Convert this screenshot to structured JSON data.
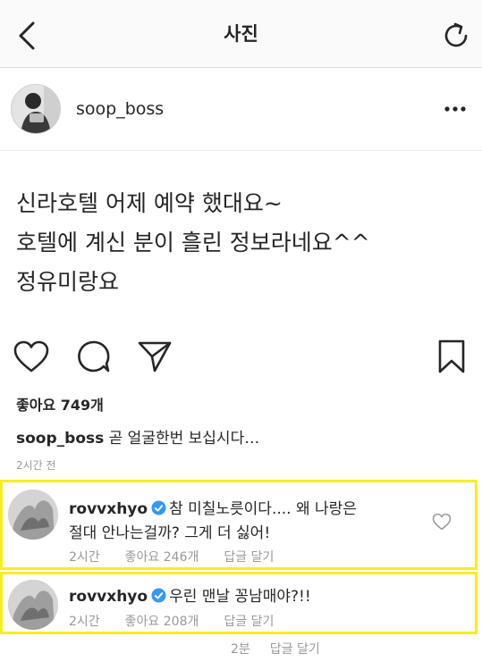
{
  "topbar": {
    "title": "사진",
    "back_icon": "chevron-left-icon",
    "refresh_icon": "refresh-icon"
  },
  "post": {
    "username": "soop_boss",
    "text_lines": [
      "신라호텔 어제 예약 했대요~",
      "호텔에 계신 분이 흘린 정보라네요^^",
      "정유미랑요"
    ],
    "likes": "좋아요 749개",
    "caption_user": "soop_boss",
    "caption_text": " 곧 얼굴한번 보십시다…",
    "time": "2시간 전"
  },
  "comments": [
    {
      "username": "rovvxhyo",
      "text_line1": "참 미칠노릇이다.... 왜 나랑은",
      "text_line2": "절대 안나는걸까?  그게 더 싫어!",
      "time": "2시간",
      "likes": "좋아요 246개",
      "reply": "답글 달기"
    },
    {
      "username": "rovvxhyo",
      "text_line1": "우린 맨날 꽁남매야?!!",
      "time": "2시간",
      "likes": "좋아요 208개",
      "reply": "답글 달기"
    }
  ],
  "extra_meta": {
    "time": "2분",
    "reply": "답글 달기"
  },
  "colors": {
    "highlight": "#f5ef1e",
    "verified": "#3897f0",
    "meta": "#999999"
  }
}
